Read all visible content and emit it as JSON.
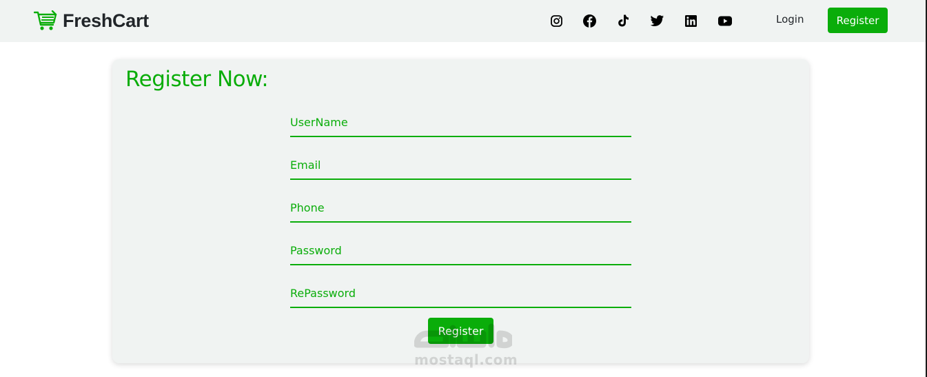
{
  "navbar": {
    "brand": "FreshCart",
    "social_icons": [
      "instagram-icon",
      "facebook-icon",
      "tiktok-icon",
      "twitter-icon",
      "linkedin-icon",
      "youtube-icon"
    ],
    "login_label": "Login",
    "register_label": "Register"
  },
  "form": {
    "title": "Register Now:",
    "fields": [
      {
        "name": "username",
        "placeholder": "UserName",
        "value": ""
      },
      {
        "name": "email",
        "placeholder": "Email",
        "value": ""
      },
      {
        "name": "phone",
        "placeholder": "Phone",
        "value": ""
      },
      {
        "name": "password",
        "placeholder": "Password",
        "value": ""
      },
      {
        "name": "repassword",
        "placeholder": "RePassword",
        "value": ""
      }
    ],
    "submit_label": "Register"
  },
  "watermark": {
    "text": "mostaql.com"
  },
  "colors": {
    "accent": "#0aad0a",
    "navbar_bg": "#f0f3f2",
    "card_bg": "#f0f3f2",
    "text_dark": "#212529"
  }
}
